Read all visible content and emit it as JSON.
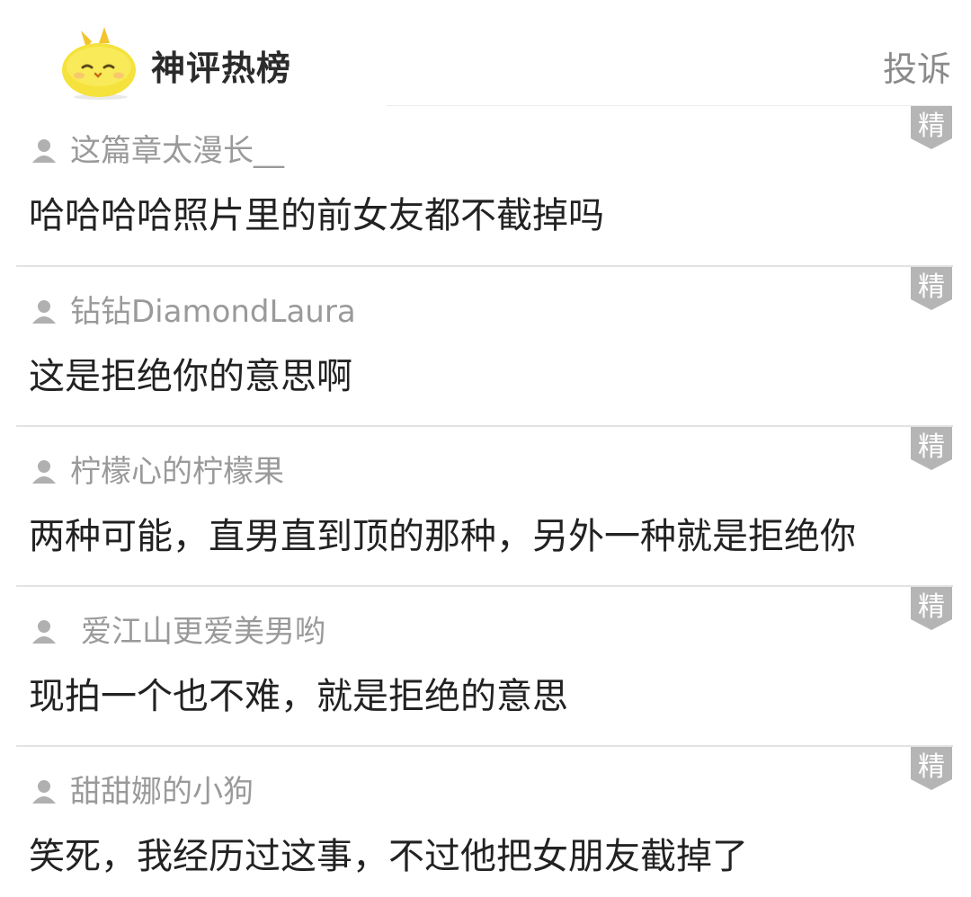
{
  "header": {
    "brand": "神评热榜",
    "report_label": "投诉",
    "logo_icon": "yellow-chick-mascot-icon"
  },
  "badge_label": "精",
  "comments": [
    {
      "username": "这篇章太漫长__",
      "text": "哈哈哈哈照片里的前女友都不截掉吗"
    },
    {
      "username": "钻钻DiamondLaura",
      "text": "这是拒绝你的意思啊"
    },
    {
      "username": "柠檬心的柠檬果",
      "text": "两种可能，直男直到顶的那种，另外一种就是拒绝你"
    },
    {
      "username": "爱江山更爱美男哟",
      "text": "现拍一个也不难，就是拒绝的意思"
    },
    {
      "username": "甜甜娜的小狗",
      "text": "笑死，我经历过这事，不过他把女朋友截掉了"
    }
  ],
  "colors": {
    "username": "#9a9a9a",
    "comment_text": "#222222",
    "badge": "#b5b5b5",
    "divider": "#e3e3e3",
    "mascot": "#f5e23c"
  }
}
